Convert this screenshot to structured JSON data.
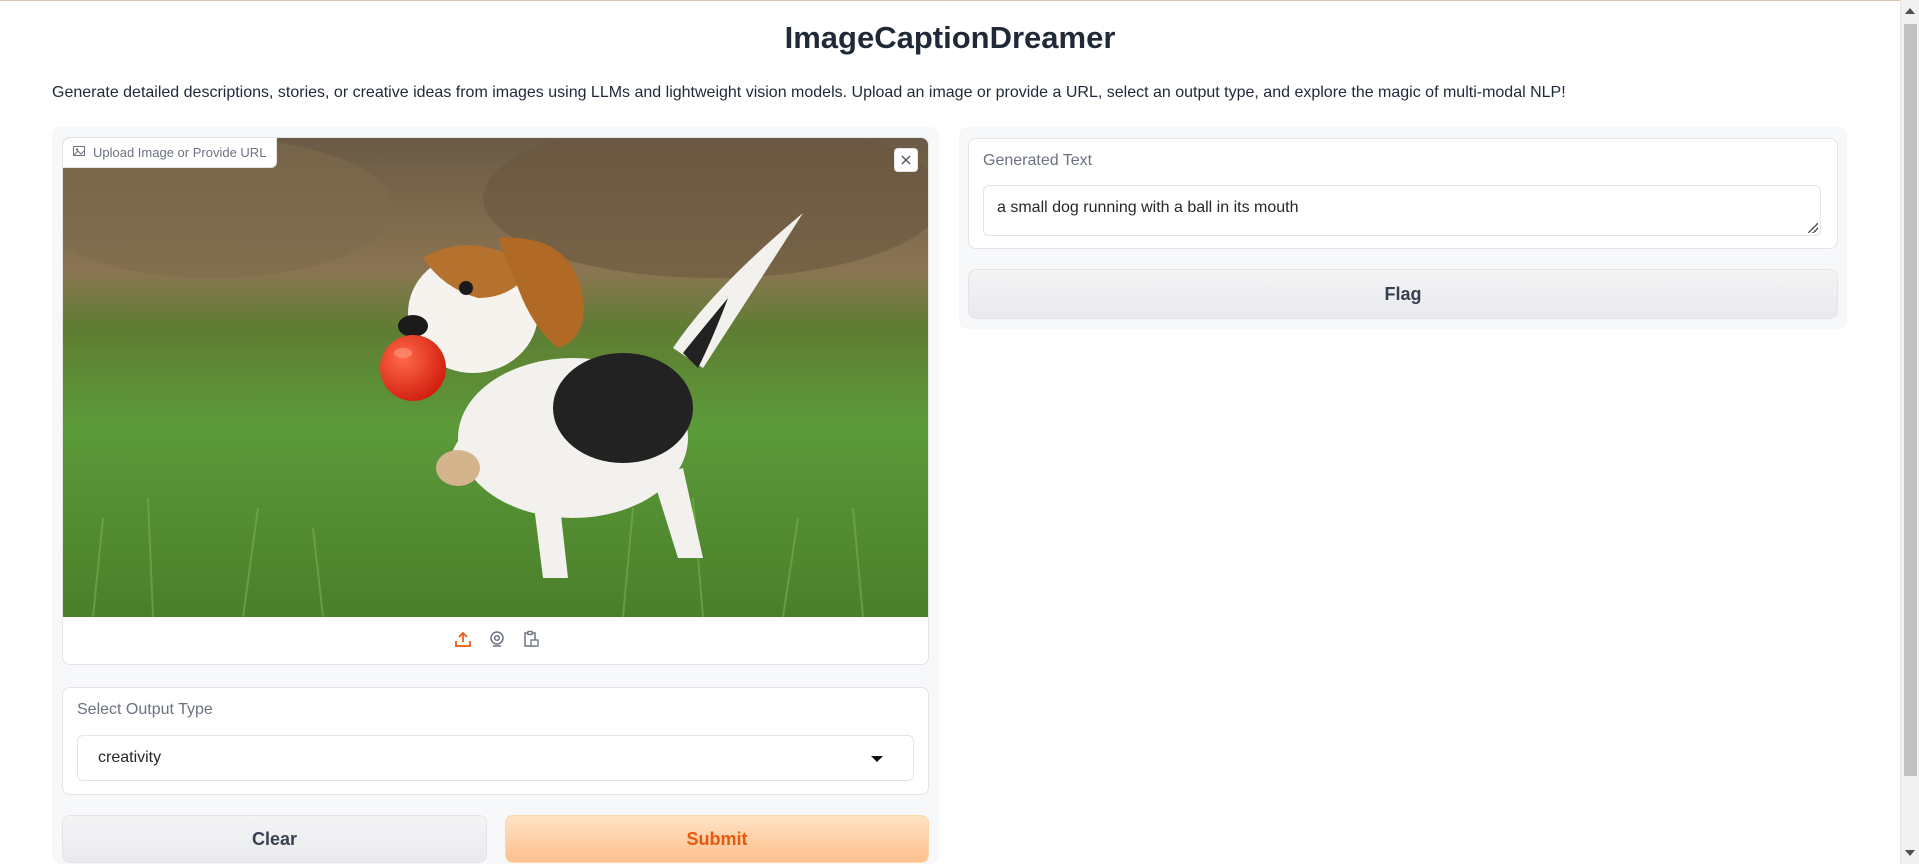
{
  "app": {
    "title": "ImageCaptionDreamer",
    "description": "Generate detailed descriptions, stories, or creative ideas from images using LLMs and lightweight vision models. Upload an image or provide a URL, select an output type, and explore the magic of multi-modal NLP!"
  },
  "image_input": {
    "label": "Upload Image or Provide URL",
    "label_icon": "image-icon",
    "close_icon": "close-icon",
    "image_subject": "beagle-puppy-with-red-ball",
    "sources": [
      {
        "icon": "upload-icon",
        "color": "#ea580c"
      },
      {
        "icon": "webcam-icon",
        "color": "#6b7280"
      },
      {
        "icon": "clipboard-icon",
        "color": "#6b7280"
      }
    ]
  },
  "output_type": {
    "label": "Select Output Type",
    "selected": "creativity"
  },
  "buttons": {
    "clear": "Clear",
    "submit": "Submit",
    "flag": "Flag"
  },
  "output": {
    "label": "Generated Text",
    "value": "a small dog running with a ball in its mouth"
  },
  "colors": {
    "accent": "#ea580c",
    "submit_bg": "#fdc08f"
  }
}
